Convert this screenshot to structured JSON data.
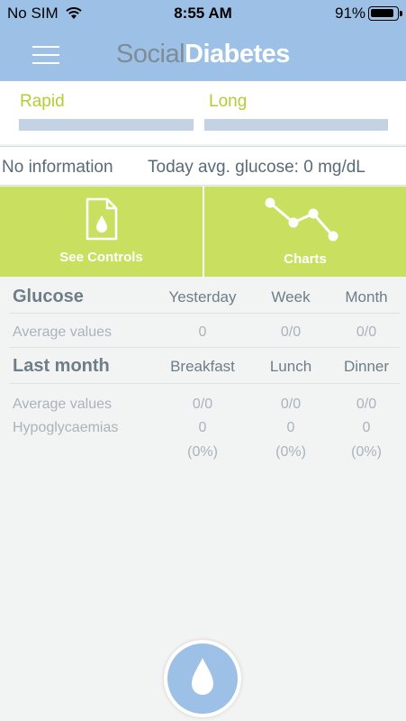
{
  "status_bar": {
    "carrier": "No SIM",
    "time": "8:55 AM",
    "battery": "91%",
    "battery_level": 0.91,
    "wifi_icon": "wifi-icon"
  },
  "header": {
    "logo_part1": "Social",
    "logo_part2": "Diabetes",
    "menu_icon": "hamburger-menu-icon"
  },
  "insulin": {
    "rapid_label": "Rapid",
    "long_label": "Long"
  },
  "info": {
    "no_info": "No information",
    "avg_glucose": "Today avg. glucose: 0 mg/dL"
  },
  "tiles": {
    "controls_label": "See Controls",
    "controls_icon": "document-drop-icon",
    "charts_label": "Charts",
    "charts_icon": "line-chart-icon"
  },
  "glucose_table": {
    "title": "Glucose",
    "columns": [
      "Yesterday",
      "Week",
      "Month"
    ],
    "row_label": "Average values",
    "values": [
      "0",
      "0/0",
      "0/0"
    ]
  },
  "last_month_table": {
    "title": "Last month",
    "columns": [
      "Breakfast",
      "Lunch",
      "Dinner"
    ],
    "avg_label": "Average values",
    "avg_values": [
      "0/0",
      "0/0",
      "0/0"
    ],
    "hypo_label": "Hypoglycaemias",
    "hypo_values": [
      "0",
      "0",
      "0"
    ],
    "hypo_pcts": [
      "(0%)",
      "(0%)",
      "(0%)"
    ]
  },
  "fab": {
    "icon": "blood-drop-icon"
  },
  "colors": {
    "header_blue": "#9dc1e6",
    "accent_green": "#c9df5f",
    "label_green": "#b5cc34"
  }
}
